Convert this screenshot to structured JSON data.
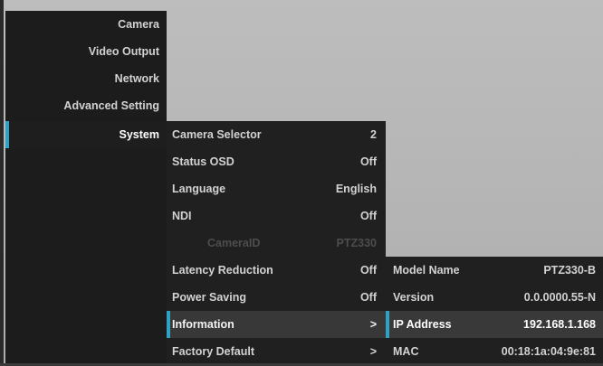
{
  "main_menu": {
    "items": [
      {
        "label": "Camera"
      },
      {
        "label": "Video Output"
      },
      {
        "label": "Network"
      },
      {
        "label": "Advanced Setting"
      },
      {
        "label": "System"
      }
    ],
    "active": "System"
  },
  "system_menu": {
    "items": [
      {
        "label": "Camera Selector",
        "value": "2"
      },
      {
        "label": "Status OSD",
        "value": "Off"
      },
      {
        "label": "Language",
        "value": "English"
      },
      {
        "label": "NDI",
        "value": "Off"
      },
      {
        "label": "CameraID",
        "value": "PTZ330"
      },
      {
        "label": "Latency Reduction",
        "value": "Off"
      },
      {
        "label": "Power Saving",
        "value": "Off"
      },
      {
        "label": "Information",
        "value": ">"
      },
      {
        "label": "Factory Default",
        "value": ">"
      }
    ]
  },
  "info_menu": {
    "items": [
      {
        "label": "Model Name",
        "value": "PTZ330-B"
      },
      {
        "label": "Version",
        "value": "0.0.0000.55-N"
      },
      {
        "label": "IP Address",
        "value": "192.168.1.168"
      },
      {
        "label": "MAC",
        "value": "00:18:1a:04:9e:81"
      }
    ]
  },
  "colors": {
    "accent": "#2fa2c4",
    "menu_bg": "#1c1c1c",
    "highlight_bg": "#383838",
    "disabled_text": "#4d4d4d",
    "video_bg": "#b9b9b9"
  }
}
